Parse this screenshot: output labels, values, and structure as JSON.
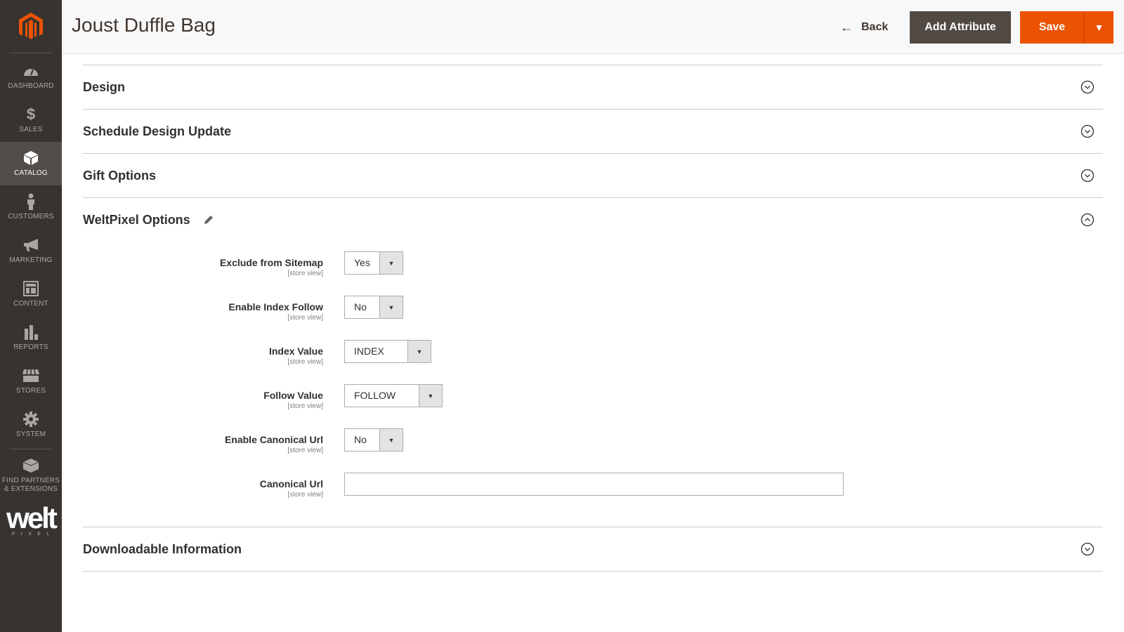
{
  "sidebar": {
    "items": [
      {
        "label": "Dashboard",
        "icon": "dashboard-icon"
      },
      {
        "label": "Sales",
        "icon": "dollar-icon"
      },
      {
        "label": "Catalog",
        "icon": "box-icon",
        "active": true
      },
      {
        "label": "Customers",
        "icon": "person-icon"
      },
      {
        "label": "Marketing",
        "icon": "megaphone-icon"
      },
      {
        "label": "Content",
        "icon": "layout-icon"
      },
      {
        "label": "Reports",
        "icon": "bar-chart-icon"
      },
      {
        "label": "Stores",
        "icon": "storefront-icon"
      },
      {
        "label": "System",
        "icon": "gear-icon"
      },
      {
        "label": "Find Partners & Extensions",
        "icon": "blocks-icon"
      }
    ],
    "brand_logo": "welt",
    "brand_sub": "PIXEL"
  },
  "header": {
    "title": "Joust Duffle Bag",
    "back_label": "Back",
    "add_attribute_label": "Add Attribute",
    "save_label": "Save"
  },
  "colors": {
    "accent": "#eb5202",
    "dark_button": "#514943",
    "sidebar_bg": "#373330"
  },
  "sections": [
    {
      "title": "Design",
      "expanded": false
    },
    {
      "title": "Schedule Design Update",
      "expanded": false
    },
    {
      "title": "Gift Options",
      "expanded": false
    },
    {
      "title": "WeltPixel Options",
      "expanded": true
    },
    {
      "title": "Downloadable Information",
      "expanded": false
    }
  ],
  "weltpixel_fields": [
    {
      "label": "Exclude from Sitemap",
      "scope": "[store view]",
      "value": "Yes"
    },
    {
      "label": "Enable Index Follow",
      "scope": "[store view]",
      "value": "No"
    },
    {
      "label": "Index Value",
      "scope": "[store view]",
      "value": "INDEX"
    },
    {
      "label": "Follow Value",
      "scope": "[store view]",
      "value": "FOLLOW"
    },
    {
      "label": "Enable Canonical Url",
      "scope": "[store view]",
      "value": "No"
    },
    {
      "label": "Canonical Url",
      "scope": "[store view]",
      "value": "",
      "placeholder": ""
    }
  ]
}
